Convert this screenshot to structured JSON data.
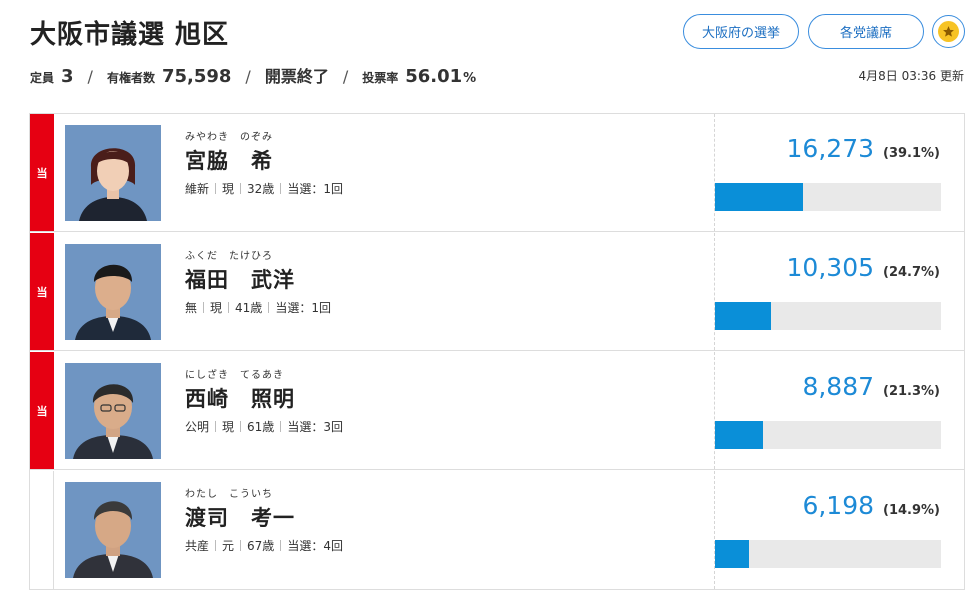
{
  "header": {
    "title": "大阪市議選 旭区",
    "prefecture_button": "大阪府の選挙",
    "seats_button": "各党議席",
    "favorite_icon": "star-icon",
    "accent_color": "#3a8dde",
    "star_color": "#f7c325"
  },
  "meta": {
    "seats_label": "定員",
    "seats_value": "3",
    "voters_label": "有権者数",
    "voters_value": "75,598",
    "status": "開票終了",
    "turnout_label": "投票率",
    "turnout_value": "56.01",
    "turnout_unit": "%",
    "separator": "/"
  },
  "updated": "4月8日 03:36 更新",
  "elected_mark": "当",
  "elected_color": "#e60012",
  "bar_color": "#0a8fd8",
  "candidates": [
    {
      "kana": "みやわき　のぞみ",
      "name": "宮脇　希",
      "party": "維新",
      "status": "現",
      "age": "32歳",
      "wins": "当選：1回",
      "votes": "16,273",
      "pct": "(39.1%)",
      "share": 0.391,
      "elected": true
    },
    {
      "kana": "ふくだ　たけひろ",
      "name": "福田　武洋",
      "party": "無",
      "status": "現",
      "age": "41歳",
      "wins": "当選：1回",
      "votes": "10,305",
      "pct": "(24.7%)",
      "share": 0.247,
      "elected": true
    },
    {
      "kana": "にしざき　てるあき",
      "name": "西崎　照明",
      "party": "公明",
      "status": "現",
      "age": "61歳",
      "wins": "当選：3回",
      "votes": "8,887",
      "pct": "(21.3%)",
      "share": 0.213,
      "elected": true
    },
    {
      "kana": "わたし　こういち",
      "name": "渡司　考一",
      "party": "共産",
      "status": "元",
      "age": "67歳",
      "wins": "当選：4回",
      "votes": "6,198",
      "pct": "(14.9%)",
      "share": 0.149,
      "elected": false
    }
  ]
}
